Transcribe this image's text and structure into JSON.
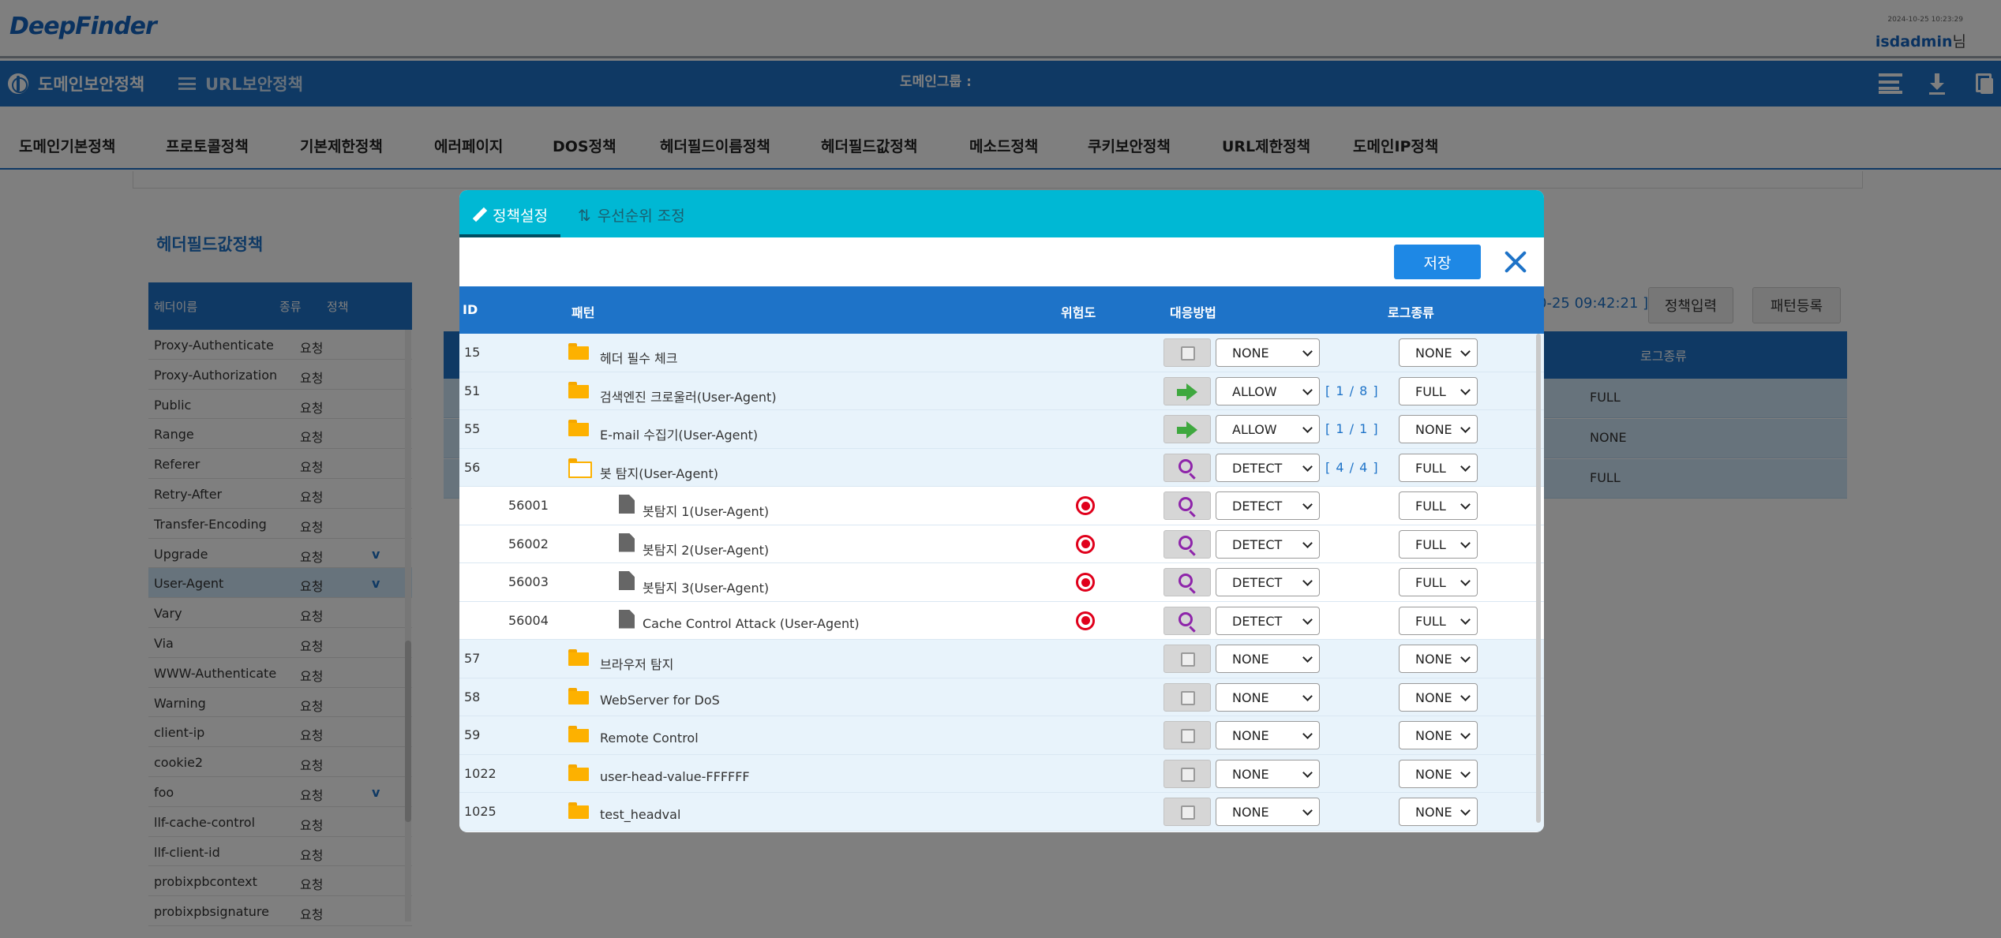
{
  "header": {
    "logo": "DeepFinder",
    "timestamp": "2024-10-25 10:23:29",
    "user": "isdadmin",
    "user_suffix": "님"
  },
  "policy_bar": {
    "domain_policy": "도메인보안정책",
    "url_policy": "URL보안정책",
    "domain_group_label": "도메인그룹 :"
  },
  "tabs": [
    "도메인기본정책",
    "프로토콜정책",
    "기본제한정책",
    "에러페이지",
    "DOS정책",
    "헤더필드이름정책",
    "헤더필드값정책",
    "메소드정책",
    "쿠키보안정책",
    "URL제한정책",
    "도메인IP정책"
  ],
  "left_panel": {
    "title": "헤더필드값정책",
    "columns": [
      "헤더이름",
      "종류",
      "정책"
    ],
    "rows": [
      {
        "name": "Proxy-Authenticate",
        "kind": "요청",
        "policy": ""
      },
      {
        "name": "Proxy-Authorization",
        "kind": "요청",
        "policy": ""
      },
      {
        "name": "Public",
        "kind": "요청",
        "policy": ""
      },
      {
        "name": "Range",
        "kind": "요청",
        "policy": ""
      },
      {
        "name": "Referer",
        "kind": "요청",
        "policy": ""
      },
      {
        "name": "Retry-After",
        "kind": "요청",
        "policy": ""
      },
      {
        "name": "Transfer-Encoding",
        "kind": "요청",
        "policy": ""
      },
      {
        "name": "Upgrade",
        "kind": "요청",
        "policy": "v"
      },
      {
        "name": "User-Agent",
        "kind": "요청",
        "policy": "v",
        "selected": true
      },
      {
        "name": "Vary",
        "kind": "요청",
        "policy": ""
      },
      {
        "name": "Via",
        "kind": "요청",
        "policy": ""
      },
      {
        "name": "WWW-Authenticate",
        "kind": "요청",
        "policy": ""
      },
      {
        "name": "Warning",
        "kind": "요청",
        "policy": ""
      },
      {
        "name": "client-ip",
        "kind": "요청",
        "policy": ""
      },
      {
        "name": "cookie2",
        "kind": "요청",
        "policy": ""
      },
      {
        "name": "foo",
        "kind": "요청",
        "policy": "v"
      },
      {
        "name": "llf-cache-control",
        "kind": "요청",
        "policy": ""
      },
      {
        "name": "llf-client-id",
        "kind": "요청",
        "policy": ""
      },
      {
        "name": "probixpbcontext",
        "kind": "요청",
        "policy": ""
      },
      {
        "name": "probixpbsignature",
        "kind": "요청",
        "policy": ""
      }
    ]
  },
  "right_panel": {
    "date_text": "0-25 09:42:21 ]",
    "btn_policy_input": "정책입력",
    "btn_pattern_register": "패턴등록",
    "col_log": "로그종류",
    "rows": [
      "FULL",
      "NONE",
      "FULL"
    ]
  },
  "modal": {
    "tab_active": "정책설정",
    "tab_inactive": "우선순위 조정",
    "save_label": "저장",
    "columns": {
      "id": "ID",
      "pattern": "패턴",
      "risk": "위험도",
      "action": "대응방법",
      "log": "로그종류"
    },
    "rows": [
      {
        "id": "15",
        "name": "헤더 필수 체크",
        "type": "group",
        "icon": "checkbox",
        "action": "NONE",
        "ratio": "",
        "log": "NONE"
      },
      {
        "id": "51",
        "name": "검색엔진 크로울러(User-Agent)",
        "type": "group",
        "icon": "allow-arrow",
        "action": "ALLOW",
        "ratio": "[   1 / 8   ]",
        "log": "FULL"
      },
      {
        "id": "55",
        "name": "E-mail 수집기(User-Agent)",
        "type": "group",
        "icon": "allow-arrow",
        "action": "ALLOW",
        "ratio": "[   1 / 1   ]",
        "log": "NONE"
      },
      {
        "id": "56",
        "name": "봇 탐지(User-Agent)",
        "type": "group-open",
        "icon": "detect",
        "action": "DETECT",
        "ratio": "[   4 / 4   ]",
        "log": "FULL"
      },
      {
        "id": "56001",
        "name": "봇탐지 1(User-Agent)",
        "type": "child",
        "icon": "detect",
        "action": "DETECT",
        "ratio": "",
        "log": "FULL"
      },
      {
        "id": "56002",
        "name": "봇탐지 2(User-Agent)",
        "type": "child",
        "icon": "detect",
        "action": "DETECT",
        "ratio": "",
        "log": "FULL"
      },
      {
        "id": "56003",
        "name": "봇탐지 3(User-Agent)",
        "type": "child",
        "icon": "detect",
        "action": "DETECT",
        "ratio": "",
        "log": "FULL"
      },
      {
        "id": "56004",
        "name": "Cache Control Attack (User-Agent)",
        "type": "child",
        "icon": "detect",
        "action": "DETECT",
        "ratio": "",
        "log": "FULL"
      },
      {
        "id": "57",
        "name": "브라우저 탐지",
        "type": "group",
        "icon": "checkbox",
        "action": "NONE",
        "ratio": "",
        "log": "NONE"
      },
      {
        "id": "58",
        "name": "WebServer for DoS",
        "type": "group",
        "icon": "checkbox",
        "action": "NONE",
        "ratio": "",
        "log": "NONE"
      },
      {
        "id": "59",
        "name": "Remote Control",
        "type": "group",
        "icon": "checkbox",
        "action": "NONE",
        "ratio": "",
        "log": "NONE"
      },
      {
        "id": "1022",
        "name": "user-head-value-FFFFFF",
        "type": "group",
        "icon": "checkbox",
        "action": "NONE",
        "ratio": "",
        "log": "NONE"
      },
      {
        "id": "1025",
        "name": "test_headval",
        "type": "group",
        "icon": "checkbox",
        "action": "NONE",
        "ratio": "",
        "log": "NONE"
      }
    ]
  }
}
